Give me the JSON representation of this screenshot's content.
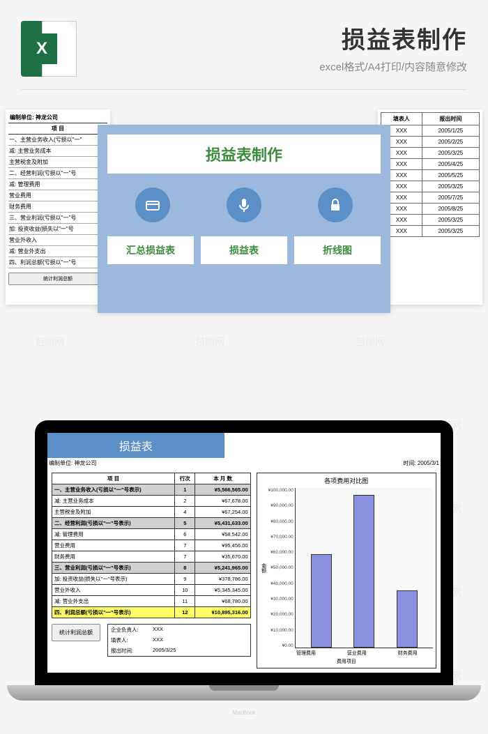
{
  "header": {
    "title": "损益表制作",
    "subtitle": "excel格式/A4打印/内容随意修改",
    "icon_letter": "X"
  },
  "watermark": "包图网",
  "card_left": {
    "header1": "编制单位: 神龙公司",
    "header2": "项  目",
    "rows": [
      "一、主营业务收入(亏损以\"一\"",
      "减: 主营业务成本",
      "    主营税金及附加",
      "二、经营利润(亏损以\"一\"号",
      "减: 管理费用",
      "    营业费用",
      "    财务费用",
      "三、营业利润(亏损以\"一\"号",
      "加: 投资收益(损失以\"一\"号",
      "    营业外收入",
      "减: 营业外支出",
      "四、利润总额(亏损以\"一\"号"
    ],
    "button": "统计利润总额"
  },
  "card_right": {
    "headers": [
      "填表人",
      "报出时间"
    ],
    "rows": [
      [
        "XXX",
        "2005/1/25"
      ],
      [
        "XXX",
        "2005/2/25"
      ],
      [
        "XXX",
        "2005/3/25"
      ],
      [
        "XXX",
        "2005/4/25"
      ],
      [
        "XXX",
        "2005/5/25"
      ],
      [
        "XXX",
        "2005/3/25"
      ],
      [
        "XXX",
        "2005/7/25"
      ],
      [
        "XXX",
        "2005/8/25"
      ],
      [
        "XXX",
        "2005/3/25"
      ],
      [
        "XXX",
        "2005/3/25"
      ]
    ]
  },
  "card_center": {
    "title": "损益表制作",
    "tabs": [
      "汇总损益表",
      "损益表",
      "折线图"
    ]
  },
  "laptop": {
    "brand": "MacBook",
    "sheet_title": "损益表",
    "unit": "编制单位: 神龙公司",
    "time_label": "时间:",
    "time_value": "2005/3/1",
    "table_headers": [
      "项  目",
      "行次",
      "本 月 数"
    ],
    "rows": [
      {
        "label": "一、主营业务收入(亏损以\"一\"号表示)",
        "n": "1",
        "v": "¥5,566,565.00",
        "hl": true
      },
      {
        "label": "减: 主营业务成本",
        "n": "2",
        "v": "¥67,678.00"
      },
      {
        "label": "    主营税金及附加",
        "n": "4",
        "v": "¥67,254.00"
      },
      {
        "label": "二、经营利润(亏损以\"一\"号表示)",
        "n": "5",
        "v": "¥5,431,633.00",
        "hl": true
      },
      {
        "label": "减: 管理费用",
        "n": "6",
        "v": "¥58,542.00"
      },
      {
        "label": "    营业费用",
        "n": "7",
        "v": "¥95,456.00"
      },
      {
        "label": "    财务费用",
        "n": "7",
        "v": "¥35,670.00"
      },
      {
        "label": "三、营业利润(亏损以\"一\"号表示)",
        "n": "8",
        "v": "¥5,241,965.00",
        "hl": true
      },
      {
        "label": "加: 投资收益(损失以\"一\"号表示)",
        "n": "9",
        "v": "¥378,786.00"
      },
      {
        "label": "    营业外收入",
        "n": "10",
        "v": "¥5,345,345.00"
      },
      {
        "label": "减: 营业外支出",
        "n": "11",
        "v": "¥68,780.00"
      },
      {
        "label": "四、利润总额(亏损以\"一\"号表示)",
        "n": "12",
        "v": "¥10,895,316.00",
        "total": true
      }
    ],
    "stat_button": "统计利润总额",
    "info": [
      [
        "企业负责人:",
        "XXX"
      ],
      [
        "填表人:",
        "XXX"
      ],
      [
        "报出时间:",
        "2005/3/25"
      ]
    ]
  },
  "chart_data": {
    "type": "bar",
    "title": "各项费用对比图",
    "ylabel": "金额",
    "xlabel": "费用项目",
    "categories": [
      "管理费用",
      "营业费用",
      "财务费用"
    ],
    "values": [
      58542,
      95456,
      35670
    ],
    "ylim": [
      0,
      100000
    ],
    "yticks": [
      "¥100,000.00",
      "¥90,000.00",
      "¥80,000.00",
      "¥70,000.00",
      "¥60,000.00",
      "¥50,000.00",
      "¥40,000.00",
      "¥30,000.00",
      "¥20,000.00",
      "¥10,000.00",
      "¥0.00"
    ]
  }
}
